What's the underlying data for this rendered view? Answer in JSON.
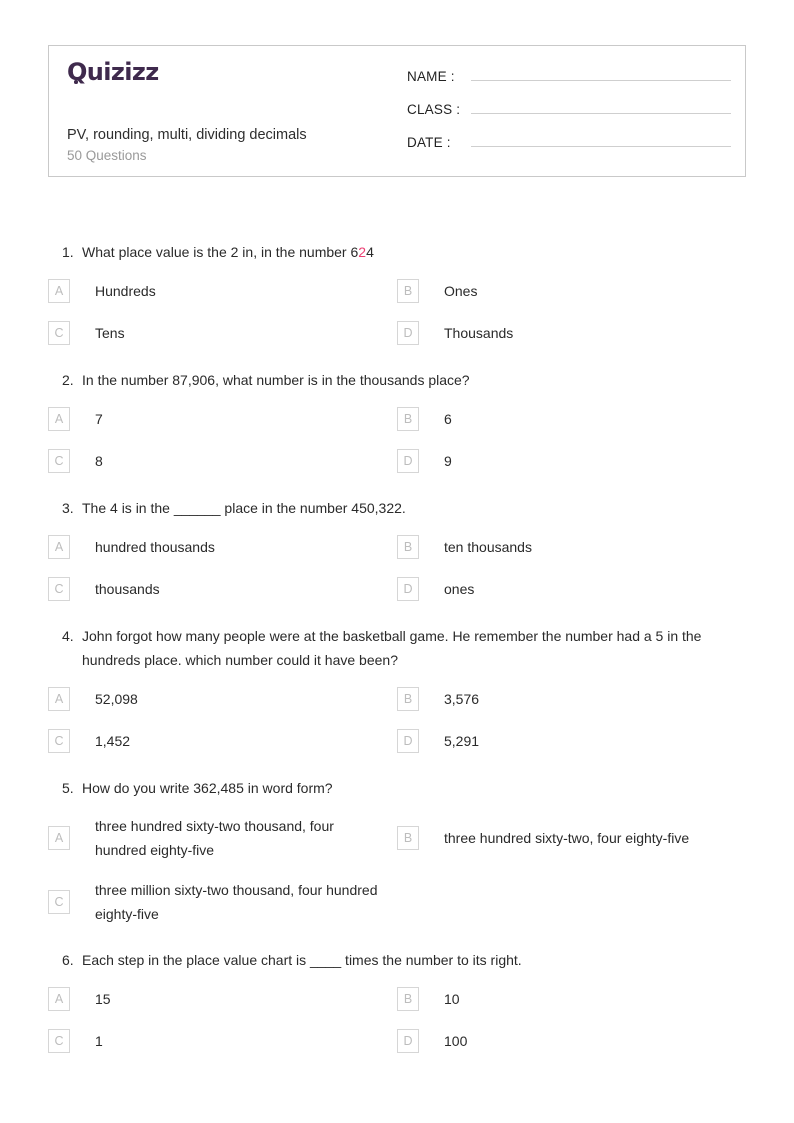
{
  "brand": {
    "logo_text": "Quizizz",
    "logo_color": "#3f2a4d",
    "accent_highlight_color": "#ec3f73"
  },
  "header": {
    "worksheet_title": "PV, rounding, multi, dividing decimals",
    "question_count_label": "50 Questions",
    "fields": [
      {
        "label": "NAME :",
        "value": ""
      },
      {
        "label": "CLASS :",
        "value": ""
      },
      {
        "label": "DATE  :",
        "value": ""
      }
    ]
  },
  "questions": [
    {
      "number": "1.",
      "text_before": "What place value is the 2 in, in the number 6",
      "highlight": "2",
      "text_after": "4",
      "layout": "normal",
      "options": [
        {
          "letter": "A",
          "text": "Hundreds"
        },
        {
          "letter": "B",
          "text": "Ones"
        },
        {
          "letter": "C",
          "text": "Tens"
        },
        {
          "letter": "D",
          "text": "Thousands"
        }
      ]
    },
    {
      "number": "2.",
      "text_before": "In the number 87,906, what number is in the thousands place?",
      "highlight": "",
      "text_after": "",
      "layout": "normal",
      "options": [
        {
          "letter": "A",
          "text": "7"
        },
        {
          "letter": "B",
          "text": "6"
        },
        {
          "letter": "C",
          "text": "8"
        },
        {
          "letter": "D",
          "text": "9"
        }
      ]
    },
    {
      "number": "3.",
      "text_before": "The 4 is in the ______ place in the number 450,322.",
      "highlight": "",
      "text_after": "",
      "layout": "normal",
      "options": [
        {
          "letter": "A",
          "text": "hundred thousands"
        },
        {
          "letter": "B",
          "text": "ten thousands"
        },
        {
          "letter": "C",
          "text": "thousands"
        },
        {
          "letter": "D",
          "text": "ones"
        }
      ]
    },
    {
      "number": "4.",
      "text_before": "John forgot how many people were at the basketball game. He remember the number had a 5 in the hundreds place. which number could it have been?",
      "highlight": "",
      "text_after": "",
      "layout": "normal",
      "options": [
        {
          "letter": "A",
          "text": "52,098"
        },
        {
          "letter": "B",
          "text": "3,576"
        },
        {
          "letter": "C",
          "text": "1,452"
        },
        {
          "letter": "D",
          "text": "5,291"
        }
      ]
    },
    {
      "number": "5.",
      "text_before": "How do you write 362,485 in word form?",
      "highlight": "",
      "text_after": "",
      "layout": "tall",
      "options": [
        {
          "letter": "A",
          "text": "three hundred sixty-two thousand, four hundred eighty-five"
        },
        {
          "letter": "B",
          "text": "three hundred sixty-two, four eighty-five"
        },
        {
          "letter": "C",
          "text": "three million sixty-two thousand, four hundred eighty-five"
        }
      ]
    },
    {
      "number": "6.",
      "text_before": "Each step in the place value chart is ____ times the number to its right.",
      "highlight": "",
      "text_after": "",
      "layout": "normal",
      "options": [
        {
          "letter": "A",
          "text": "15"
        },
        {
          "letter": "B",
          "text": "10"
        },
        {
          "letter": "C",
          "text": "1"
        },
        {
          "letter": "D",
          "text": "100"
        }
      ]
    }
  ]
}
